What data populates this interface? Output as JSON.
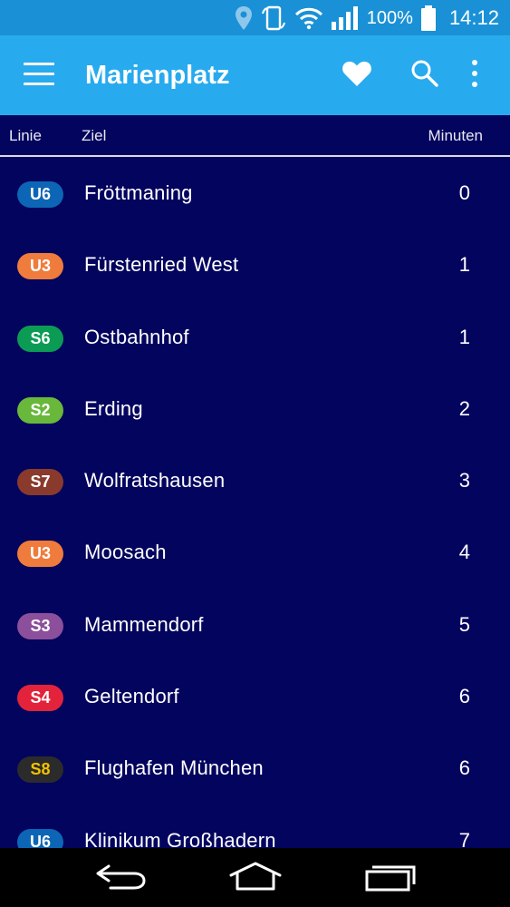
{
  "status_bar": {
    "battery_text": "100%",
    "time": "14:12",
    "icons": [
      "location-icon",
      "rotate-icon",
      "wifi-icon",
      "signal-icon",
      "battery-icon"
    ]
  },
  "app_bar": {
    "title": "Marienplatz",
    "icons": [
      "menu-icon",
      "heart-icon",
      "search-icon",
      "more-vert-icon"
    ]
  },
  "columns": {
    "linie": "Linie",
    "ziel": "Ziel",
    "minuten": "Minuten"
  },
  "departures": [
    {
      "line": "U6",
      "destination": "Fröttmaning",
      "minutes": "0",
      "color": "#0d65b5",
      "text_color": "#ffffff"
    },
    {
      "line": "U3",
      "destination": "Fürstenried West",
      "minutes": "1",
      "color": "#ef7c3c",
      "text_color": "#ffffff"
    },
    {
      "line": "S6",
      "destination": "Ostbahnhof",
      "minutes": "1",
      "color": "#0c9b55",
      "text_color": "#ffffff"
    },
    {
      "line": "S2",
      "destination": "Erding",
      "minutes": "2",
      "color": "#69b83b",
      "text_color": "#ffffff"
    },
    {
      "line": "S7",
      "destination": "Wolfratshausen",
      "minutes": "3",
      "color": "#8a3a2c",
      "text_color": "#ffffff"
    },
    {
      "line": "U3",
      "destination": "Moosach",
      "minutes": "4",
      "color": "#ef7c3c",
      "text_color": "#ffffff"
    },
    {
      "line": "S3",
      "destination": "Mammendorf",
      "minutes": "5",
      "color": "#8c4f9b",
      "text_color": "#ffffff"
    },
    {
      "line": "S4",
      "destination": "Geltendorf",
      "minutes": "6",
      "color": "#e3233b",
      "text_color": "#ffffff"
    },
    {
      "line": "S8",
      "destination": "Flughafen München",
      "minutes": "6",
      "color": "#2b2b2b",
      "text_color": "#f3c100"
    },
    {
      "line": "U6",
      "destination": "Klinikum Großhadern",
      "minutes": "7",
      "color": "#0d65b5",
      "text_color": "#ffffff"
    }
  ],
  "colors": {
    "status_bar": "#1a91d6",
    "app_bar": "#28aaee",
    "background": "#03045e",
    "nav_bar": "#000000"
  },
  "nav_bar": {
    "icons": [
      "back-icon",
      "home-icon",
      "recent-apps-icon"
    ]
  }
}
